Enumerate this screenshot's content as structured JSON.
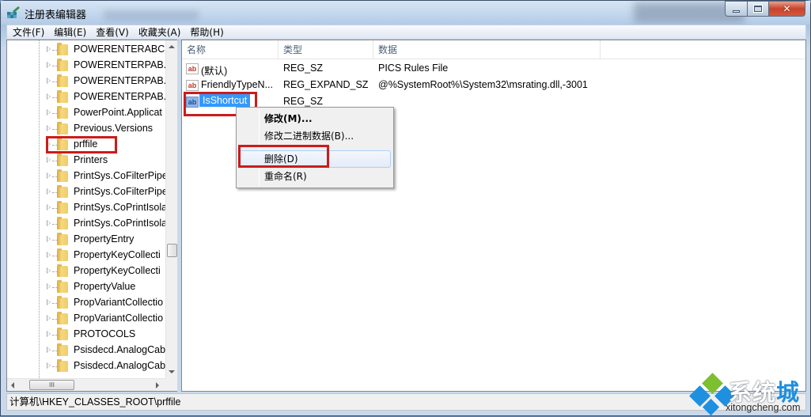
{
  "window": {
    "title": "注册表编辑器",
    "controls": {
      "minimize": "–",
      "maximize": "□",
      "close": "✕"
    }
  },
  "menubar": [
    "文件(F)",
    "编辑(E)",
    "查看(V)",
    "收藏夹(A)",
    "帮助(H)"
  ],
  "tree": {
    "items": [
      "POWERENTERABC.F",
      "POWERENTERPAB.F",
      "POWERENTERPAB.F",
      "POWERENTERPAB.F",
      "PowerPoint.Applicat",
      "Previous.Versions",
      "prffile",
      "Printers",
      "PrintSys.CoFilterPipe",
      "PrintSys.CoFilterPipe",
      "PrintSys.CoPrintIsola",
      "PrintSys.CoPrintIsola",
      "PropertyEntry",
      "PropertyKeyCollecti",
      "PropertyKeyCollecti",
      "PropertyValue",
      "PropVariantCollectio",
      "PropVariantCollectio",
      "PROTOCOLS",
      "Psisdecd.AnalogCab",
      "Psisdecd.AnalogCab"
    ],
    "selected": "prffile",
    "hscroll_thumb_glyph": "III"
  },
  "list": {
    "columns": [
      "名称",
      "类型",
      "数据"
    ],
    "rows": [
      {
        "icon": "string-value-icon",
        "name": "(默认)",
        "type": "REG_SZ",
        "data": "PICS Rules File"
      },
      {
        "icon": "string-value-icon",
        "name": "FriendlyTypeN...",
        "type": "REG_EXPAND_SZ",
        "data": "@%SystemRoot%\\System32\\msrating.dll,-3001"
      },
      {
        "icon": "string-value-icon",
        "name": "IsShortcut",
        "type": "REG_SZ",
        "data": ""
      }
    ],
    "selected": "IsShortcut",
    "icon_glyph": "ab"
  },
  "context_menu": {
    "items": [
      {
        "label": "修改(M)...",
        "default": true
      },
      {
        "label": "修改二进制数据(B)...",
        "default": false
      },
      {
        "label": "删除(D)",
        "default": false,
        "hover": true
      },
      {
        "label": "重命名(R)",
        "default": false
      }
    ]
  },
  "statusbar": {
    "path": "计算机\\HKEY_CLASSES_ROOT\\prffile"
  },
  "watermark": {
    "brand_left": "系统",
    "brand_right": "城",
    "url": "xitongcheng.com"
  },
  "colors": {
    "highlight_box": "#cc1b1b",
    "selection": "#3399ff",
    "brand_blue": "#1f8fe0",
    "brand_green": "#7cbf2f"
  }
}
